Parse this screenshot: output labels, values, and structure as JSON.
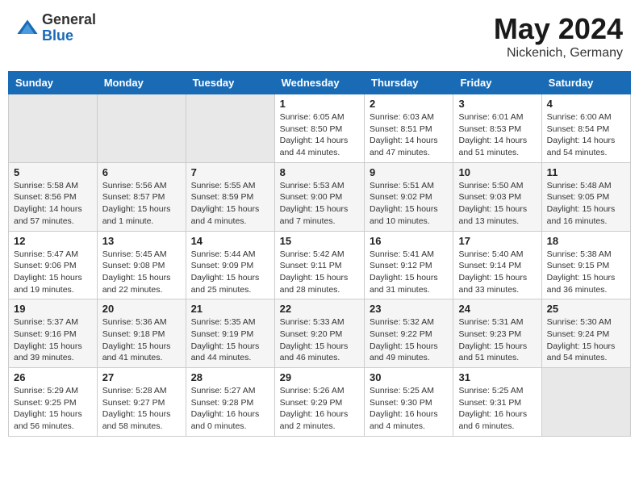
{
  "header": {
    "logo_general": "General",
    "logo_blue": "Blue",
    "month_title": "May 2024",
    "location": "Nickenich, Germany"
  },
  "weekdays": [
    "Sunday",
    "Monday",
    "Tuesday",
    "Wednesday",
    "Thursday",
    "Friday",
    "Saturday"
  ],
  "weeks": [
    [
      {
        "day": "",
        "sunrise": "",
        "sunset": "",
        "daylight": "",
        "empty": true
      },
      {
        "day": "",
        "sunrise": "",
        "sunset": "",
        "daylight": "",
        "empty": true
      },
      {
        "day": "",
        "sunrise": "",
        "sunset": "",
        "daylight": "",
        "empty": true
      },
      {
        "day": "1",
        "sunrise": "Sunrise: 6:05 AM",
        "sunset": "Sunset: 8:50 PM",
        "daylight": "Daylight: 14 hours and 44 minutes."
      },
      {
        "day": "2",
        "sunrise": "Sunrise: 6:03 AM",
        "sunset": "Sunset: 8:51 PM",
        "daylight": "Daylight: 14 hours and 47 minutes."
      },
      {
        "day": "3",
        "sunrise": "Sunrise: 6:01 AM",
        "sunset": "Sunset: 8:53 PM",
        "daylight": "Daylight: 14 hours and 51 minutes."
      },
      {
        "day": "4",
        "sunrise": "Sunrise: 6:00 AM",
        "sunset": "Sunset: 8:54 PM",
        "daylight": "Daylight: 14 hours and 54 minutes."
      }
    ],
    [
      {
        "day": "5",
        "sunrise": "Sunrise: 5:58 AM",
        "sunset": "Sunset: 8:56 PM",
        "daylight": "Daylight: 14 hours and 57 minutes."
      },
      {
        "day": "6",
        "sunrise": "Sunrise: 5:56 AM",
        "sunset": "Sunset: 8:57 PM",
        "daylight": "Daylight: 15 hours and 1 minute."
      },
      {
        "day": "7",
        "sunrise": "Sunrise: 5:55 AM",
        "sunset": "Sunset: 8:59 PM",
        "daylight": "Daylight: 15 hours and 4 minutes."
      },
      {
        "day": "8",
        "sunrise": "Sunrise: 5:53 AM",
        "sunset": "Sunset: 9:00 PM",
        "daylight": "Daylight: 15 hours and 7 minutes."
      },
      {
        "day": "9",
        "sunrise": "Sunrise: 5:51 AM",
        "sunset": "Sunset: 9:02 PM",
        "daylight": "Daylight: 15 hours and 10 minutes."
      },
      {
        "day": "10",
        "sunrise": "Sunrise: 5:50 AM",
        "sunset": "Sunset: 9:03 PM",
        "daylight": "Daylight: 15 hours and 13 minutes."
      },
      {
        "day": "11",
        "sunrise": "Sunrise: 5:48 AM",
        "sunset": "Sunset: 9:05 PM",
        "daylight": "Daylight: 15 hours and 16 minutes."
      }
    ],
    [
      {
        "day": "12",
        "sunrise": "Sunrise: 5:47 AM",
        "sunset": "Sunset: 9:06 PM",
        "daylight": "Daylight: 15 hours and 19 minutes."
      },
      {
        "day": "13",
        "sunrise": "Sunrise: 5:45 AM",
        "sunset": "Sunset: 9:08 PM",
        "daylight": "Daylight: 15 hours and 22 minutes."
      },
      {
        "day": "14",
        "sunrise": "Sunrise: 5:44 AM",
        "sunset": "Sunset: 9:09 PM",
        "daylight": "Daylight: 15 hours and 25 minutes."
      },
      {
        "day": "15",
        "sunrise": "Sunrise: 5:42 AM",
        "sunset": "Sunset: 9:11 PM",
        "daylight": "Daylight: 15 hours and 28 minutes."
      },
      {
        "day": "16",
        "sunrise": "Sunrise: 5:41 AM",
        "sunset": "Sunset: 9:12 PM",
        "daylight": "Daylight: 15 hours and 31 minutes."
      },
      {
        "day": "17",
        "sunrise": "Sunrise: 5:40 AM",
        "sunset": "Sunset: 9:14 PM",
        "daylight": "Daylight: 15 hours and 33 minutes."
      },
      {
        "day": "18",
        "sunrise": "Sunrise: 5:38 AM",
        "sunset": "Sunset: 9:15 PM",
        "daylight": "Daylight: 15 hours and 36 minutes."
      }
    ],
    [
      {
        "day": "19",
        "sunrise": "Sunrise: 5:37 AM",
        "sunset": "Sunset: 9:16 PM",
        "daylight": "Daylight: 15 hours and 39 minutes."
      },
      {
        "day": "20",
        "sunrise": "Sunrise: 5:36 AM",
        "sunset": "Sunset: 9:18 PM",
        "daylight": "Daylight: 15 hours and 41 minutes."
      },
      {
        "day": "21",
        "sunrise": "Sunrise: 5:35 AM",
        "sunset": "Sunset: 9:19 PM",
        "daylight": "Daylight: 15 hours and 44 minutes."
      },
      {
        "day": "22",
        "sunrise": "Sunrise: 5:33 AM",
        "sunset": "Sunset: 9:20 PM",
        "daylight": "Daylight: 15 hours and 46 minutes."
      },
      {
        "day": "23",
        "sunrise": "Sunrise: 5:32 AM",
        "sunset": "Sunset: 9:22 PM",
        "daylight": "Daylight: 15 hours and 49 minutes."
      },
      {
        "day": "24",
        "sunrise": "Sunrise: 5:31 AM",
        "sunset": "Sunset: 9:23 PM",
        "daylight": "Daylight: 15 hours and 51 minutes."
      },
      {
        "day": "25",
        "sunrise": "Sunrise: 5:30 AM",
        "sunset": "Sunset: 9:24 PM",
        "daylight": "Daylight: 15 hours and 54 minutes."
      }
    ],
    [
      {
        "day": "26",
        "sunrise": "Sunrise: 5:29 AM",
        "sunset": "Sunset: 9:25 PM",
        "daylight": "Daylight: 15 hours and 56 minutes."
      },
      {
        "day": "27",
        "sunrise": "Sunrise: 5:28 AM",
        "sunset": "Sunset: 9:27 PM",
        "daylight": "Daylight: 15 hours and 58 minutes."
      },
      {
        "day": "28",
        "sunrise": "Sunrise: 5:27 AM",
        "sunset": "Sunset: 9:28 PM",
        "daylight": "Daylight: 16 hours and 0 minutes."
      },
      {
        "day": "29",
        "sunrise": "Sunrise: 5:26 AM",
        "sunset": "Sunset: 9:29 PM",
        "daylight": "Daylight: 16 hours and 2 minutes."
      },
      {
        "day": "30",
        "sunrise": "Sunrise: 5:25 AM",
        "sunset": "Sunset: 9:30 PM",
        "daylight": "Daylight: 16 hours and 4 minutes."
      },
      {
        "day": "31",
        "sunrise": "Sunrise: 5:25 AM",
        "sunset": "Sunset: 9:31 PM",
        "daylight": "Daylight: 16 hours and 6 minutes."
      },
      {
        "day": "",
        "sunrise": "",
        "sunset": "",
        "daylight": "",
        "empty": true
      }
    ]
  ]
}
